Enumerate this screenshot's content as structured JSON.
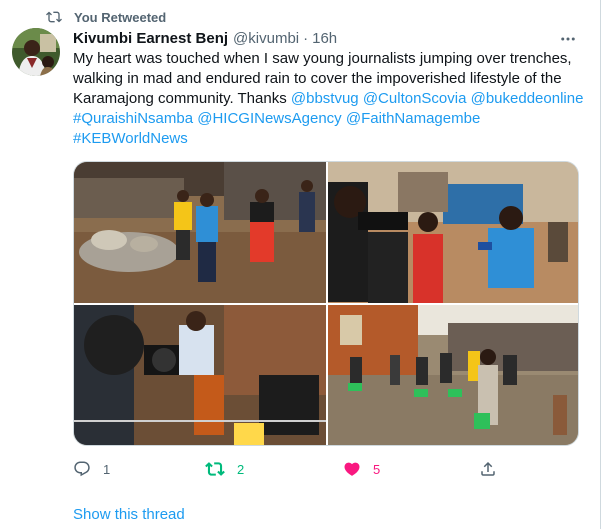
{
  "retweet": {
    "label": "You Retweeted"
  },
  "author": {
    "name": "Kivumbi Earnest Benj",
    "handle": "@kivumbi",
    "separator": "·",
    "time": "16h"
  },
  "tweet": {
    "lines": [
      "My heart was touched when I saw young  journalists jumping over trenches,",
      "walking in mad and endured rain to cover the impoverished lifestyle of the",
      "Karamajong community. Thanks"
    ],
    "mentions": [
      "@bbstvug",
      "@CultonScovia",
      "@bukeddeonline"
    ],
    "line4_parts": [
      "#QuraishiNsamba",
      "@HICGINewsAgency",
      "@FaithNamagembe"
    ],
    "last_tag": "#KEBWorldNews"
  },
  "actions": {
    "reply_count": "1",
    "retweet_count": "2",
    "like_count": "5"
  },
  "show_thread": "Show this thread",
  "colors": {
    "link": "#1d9bf0",
    "retweet_active": "#00ba7c",
    "like_active": "#f91880",
    "muted": "#536471"
  },
  "icons": [
    "retweet-icon",
    "more-icon",
    "reply-icon",
    "retweet-action-icon",
    "heart-filled-icon",
    "share-icon"
  ]
}
